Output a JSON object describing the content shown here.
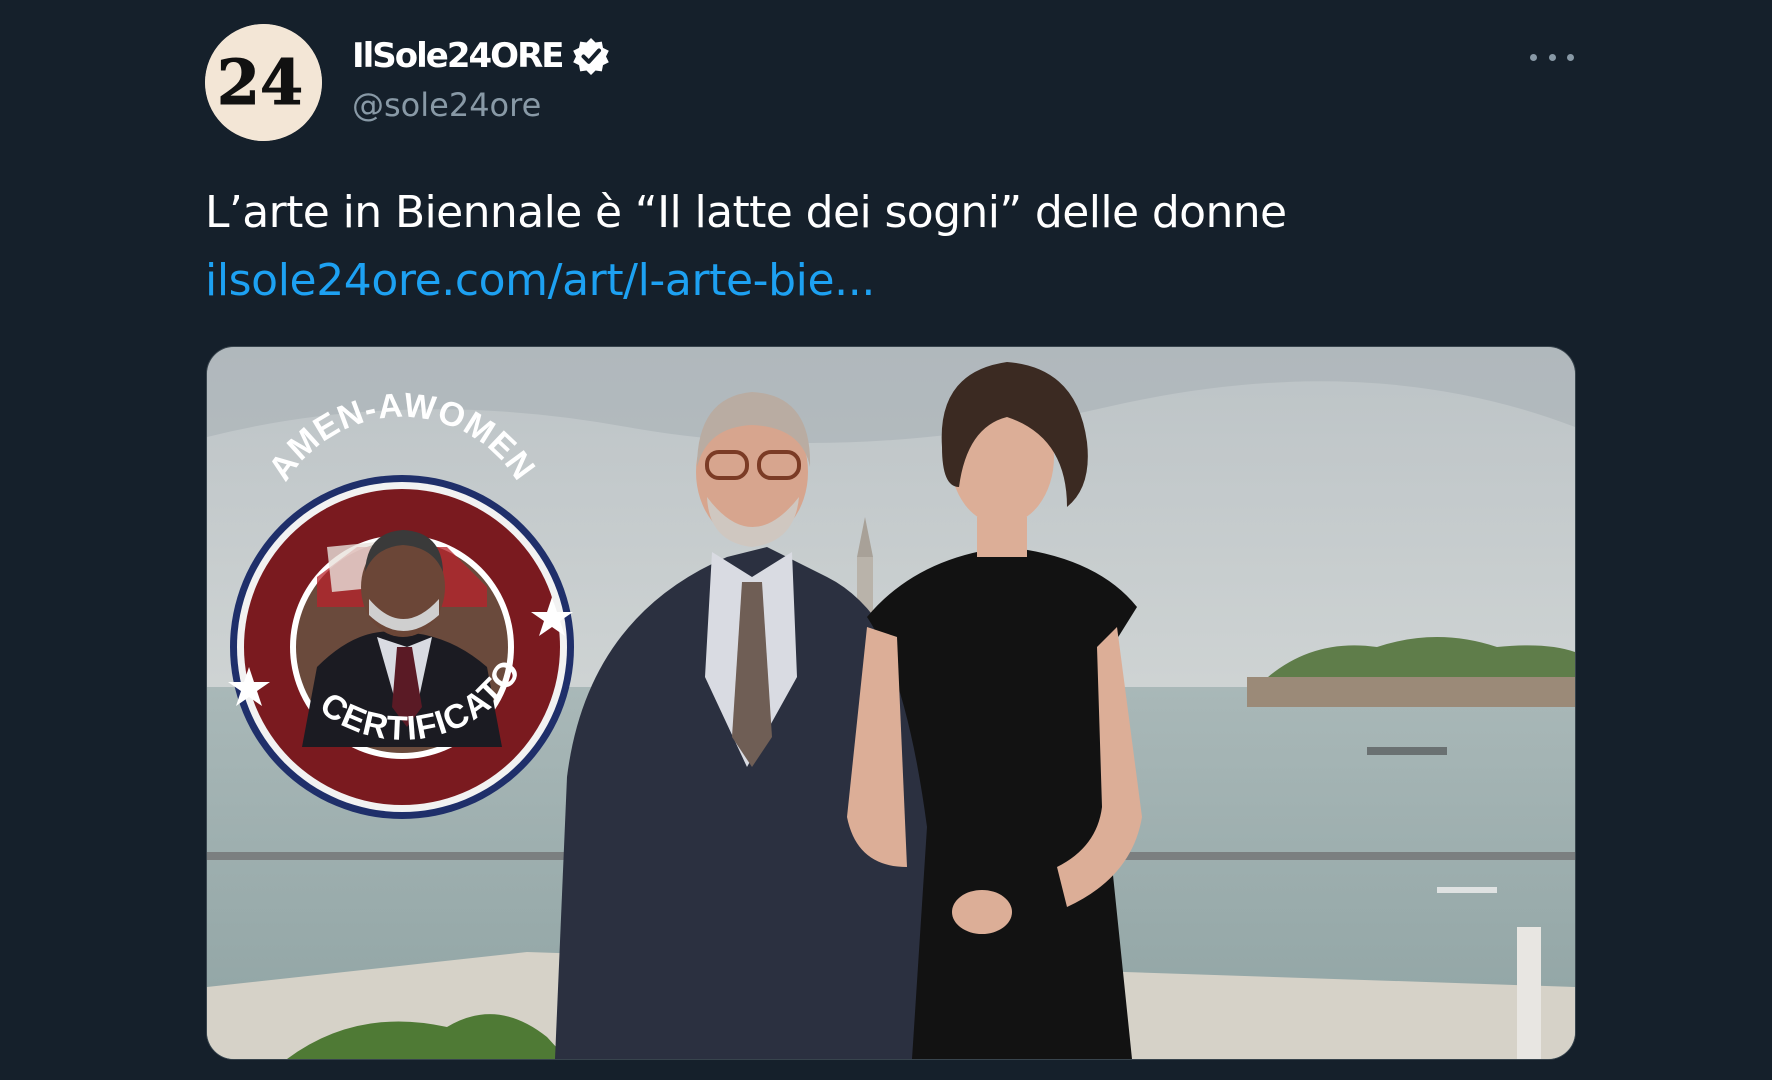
{
  "tweet": {
    "display_name": "IlSole24ORE",
    "handle": "@sole24ore",
    "verified": true,
    "avatar_logo_text": "24",
    "text": "L’arte in Biennale è “Il latte dei sogni” delle donne",
    "link_text": "ilsole24ore.com/art/l-arte-bie...",
    "more_icon": "more-horizontal-icon"
  },
  "media": {
    "description_icon": "photo",
    "badge": {
      "top_text": "AMEN-AWOMEN",
      "bottom_text": "CERTIFICATO",
      "star_icon": "star-icon"
    }
  },
  "colors": {
    "background": "#15202b",
    "link": "#1da1f2",
    "secondary_text": "#8899a6",
    "verified": "#ffffff",
    "badge_ring": "#7a1a1f",
    "badge_border": "#1f2f6a"
  }
}
